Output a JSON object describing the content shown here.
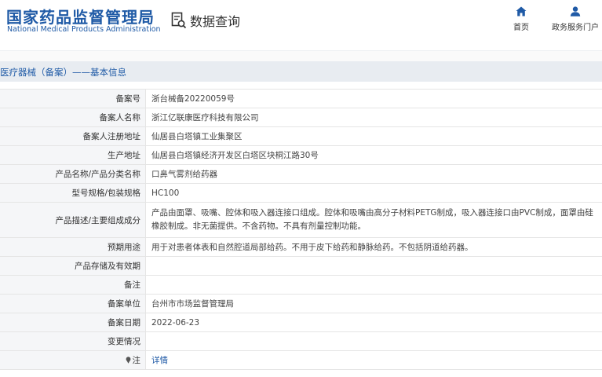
{
  "header": {
    "logo_cn": "国家药品监督管理局",
    "logo_en": "National Medical Products Administration",
    "search_title": "数据查询",
    "nav": [
      {
        "label": "首页",
        "icon": "home-icon"
      },
      {
        "label": "政务服务门户",
        "icon": "user-icon"
      }
    ],
    "accent_color": "#1f5aa6"
  },
  "section": {
    "title": "医疗器械（备案）——基本信息"
  },
  "rows": [
    {
      "label": "备案号",
      "value": "浙台械备20220059号"
    },
    {
      "label": "备案人名称",
      "value": "浙江亿联康医疗科技有限公司"
    },
    {
      "label": "备案人注册地址",
      "value": "仙居县白塔镇工业集聚区"
    },
    {
      "label": "生产地址",
      "value": "仙居县白塔镇经济开发区白塔区块桐江路30号"
    },
    {
      "label": "产品名称/产品分类名称",
      "value": "口鼻气雾剂给药器"
    },
    {
      "label": "型号规格/包装规格",
      "value": "HC100"
    },
    {
      "label": "产品描述/主要组成成分",
      "value": "产品由面罩、吸嘴、腔体和吸入器连接口组成。腔体和吸嘴由高分子材料PETG制成，吸入器连接口由PVC制成，面罩由硅橡胶制成。非无菌提供。不含药物。不具有剂量控制功能。"
    },
    {
      "label": "预期用途",
      "value": "用于对患者体表和自然腔道局部给药。不用于皮下给药和静脉给药。不包括阴道给药器。"
    },
    {
      "label": "产品存储及有效期",
      "value": ""
    },
    {
      "label": "备注",
      "value": ""
    },
    {
      "label": "备案单位",
      "value": "台州市市场监督管理局"
    },
    {
      "label": "备案日期",
      "value": "2022-06-23"
    },
    {
      "label": "变更情况",
      "value": ""
    },
    {
      "label": "注",
      "value": "详情",
      "icon": "pin-icon"
    }
  ]
}
